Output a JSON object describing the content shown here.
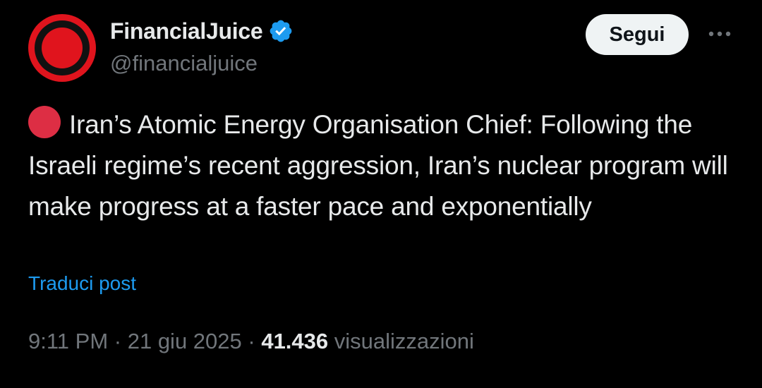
{
  "author": {
    "display_name": "FinancialJuice",
    "handle": "@financialjuice",
    "verified": true,
    "avatar_icon": "red-circle-logo"
  },
  "actions": {
    "follow_label": "Segui",
    "more_icon": "more-dots-icon"
  },
  "post": {
    "emoji_icon": "red-circle-emoji",
    "text": "Iran’s Atomic Energy Organisation Chief: Following the Israeli regime’s recent aggression, Iran’s nuclear program will make progress at a faster pace and exponentially",
    "translate_label": "Traduci post"
  },
  "meta": {
    "time": "9:11 PM",
    "separator": " · ",
    "date": "21 giu 2025",
    "views_count": "41.436",
    "views_label": "visualizzazioni"
  },
  "colors": {
    "background": "#000000",
    "text_primary": "#e7e9ea",
    "text_secondary": "#71767b",
    "link": "#1d9bf0",
    "verified_badge": "#1d9bf0",
    "brand_red": "#e0141d",
    "emoji_red": "#dd2e44"
  }
}
